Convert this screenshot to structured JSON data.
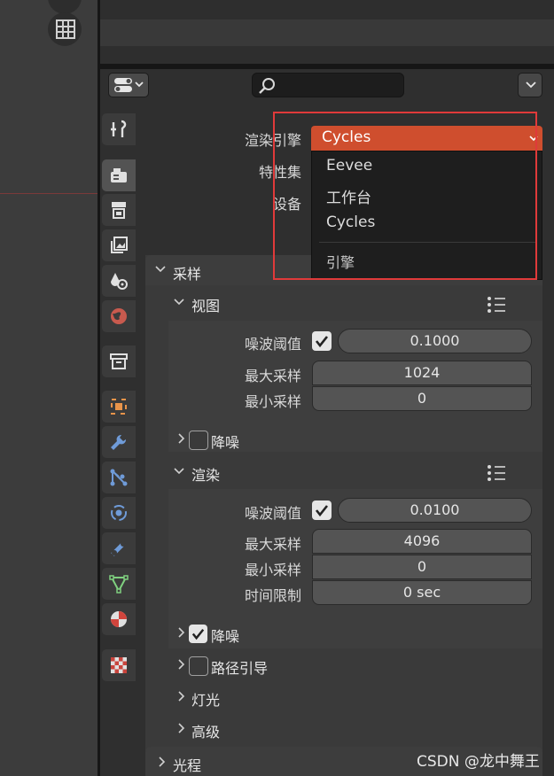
{
  "render": {
    "engine_label": "渲染引擎",
    "engine_value": "Cycles",
    "feature_set_label": "特性集",
    "device_label": "设备"
  },
  "engine_menu": {
    "items": [
      "Eevee",
      "工作台",
      "Cycles"
    ],
    "footer": "引擎"
  },
  "sampling": {
    "title": "采样",
    "viewport": {
      "title": "视图",
      "noise_threshold_label": "噪波阈值",
      "noise_threshold": "0.1000",
      "max_samples_label": "最大采样",
      "max_samples": "1024",
      "min_samples_label": "最小采样",
      "min_samples": "0",
      "denoise_label": "降噪"
    },
    "render": {
      "title": "渲染",
      "noise_threshold_label": "噪波阈值",
      "noise_threshold": "0.0100",
      "max_samples_label": "最大采样",
      "max_samples": "4096",
      "min_samples_label": "最小采样",
      "min_samples": "0",
      "time_limit_label": "时间限制",
      "time_limit": "0 sec",
      "denoise_label": "降噪"
    },
    "path_guiding_label": "路径引导",
    "lights_label": "灯光",
    "advanced_label": "高级"
  },
  "light_paths_label": "光程",
  "watermark": "CSDN @龙中舞王",
  "colors": {
    "accent": "#cf4e2e",
    "highlight_box": "#e03a3a"
  }
}
